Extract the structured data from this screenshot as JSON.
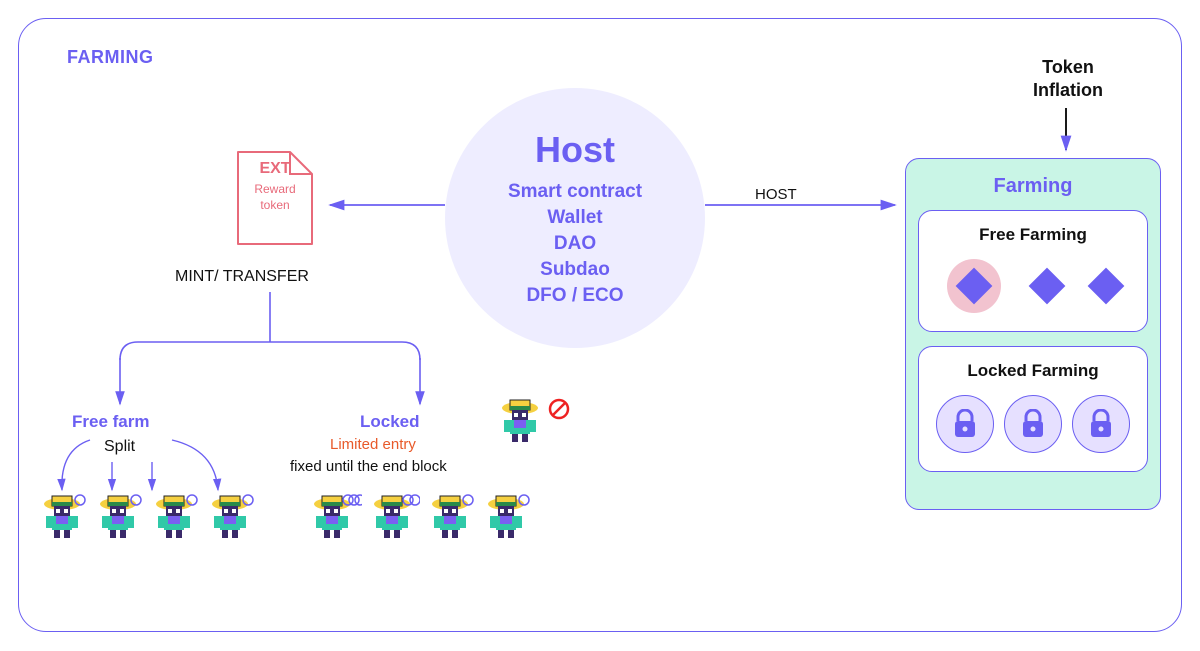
{
  "frame": {
    "title": "FARMING"
  },
  "host": {
    "title": "Host",
    "lines": [
      "Smart contract",
      "Wallet",
      "DAO",
      "Subdao",
      "DFO / ECO"
    ]
  },
  "ext": {
    "title": "EXT",
    "sub1": "Reward",
    "sub2": "token"
  },
  "labels": {
    "mint": "MINT/ TRANSFER",
    "freefarm": "Free farm",
    "split": "Split",
    "locked": "Locked",
    "limited": "Limited entry",
    "fixed": "fixed until the end block",
    "hostArrow": "HOST",
    "tokenInflation1": "Token",
    "tokenInflation2": "Inflation"
  },
  "farmingPanel": {
    "title": "Farming",
    "free": "Free Farming",
    "locked": "Locked Farming"
  }
}
